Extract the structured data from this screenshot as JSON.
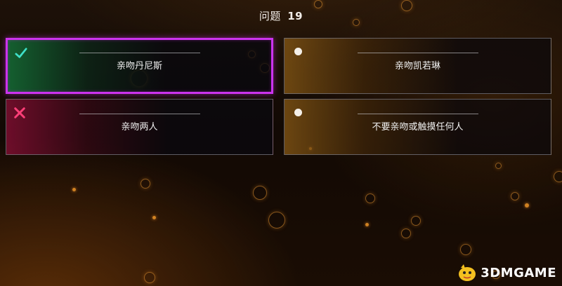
{
  "question": {
    "prefix": "问题",
    "number": "19"
  },
  "options": [
    {
      "label": "亲吻丹尼斯",
      "state": "correct",
      "marker_icon": "checkmark-icon",
      "marker_color": "#3fe0c8"
    },
    {
      "label": "亲吻凯若琳",
      "state": "unselected",
      "marker_icon": "radio-dot-icon",
      "marker_color": "#f4efe8"
    },
    {
      "label": "亲吻两人",
      "state": "wrong",
      "marker_icon": "cross-icon",
      "marker_color": "#ff3e78"
    },
    {
      "label": "不要亲吻或触摸任何人",
      "state": "unselected",
      "marker_icon": "radio-dot-icon",
      "marker_color": "#f4efe8"
    }
  ],
  "colors": {
    "highlight_border": "#cc33ee",
    "correct_tint": "#146e37",
    "wrong_tint": "#7d0e30",
    "neutral_tint": "#825514"
  },
  "watermark": {
    "text": "3DMGAME"
  }
}
